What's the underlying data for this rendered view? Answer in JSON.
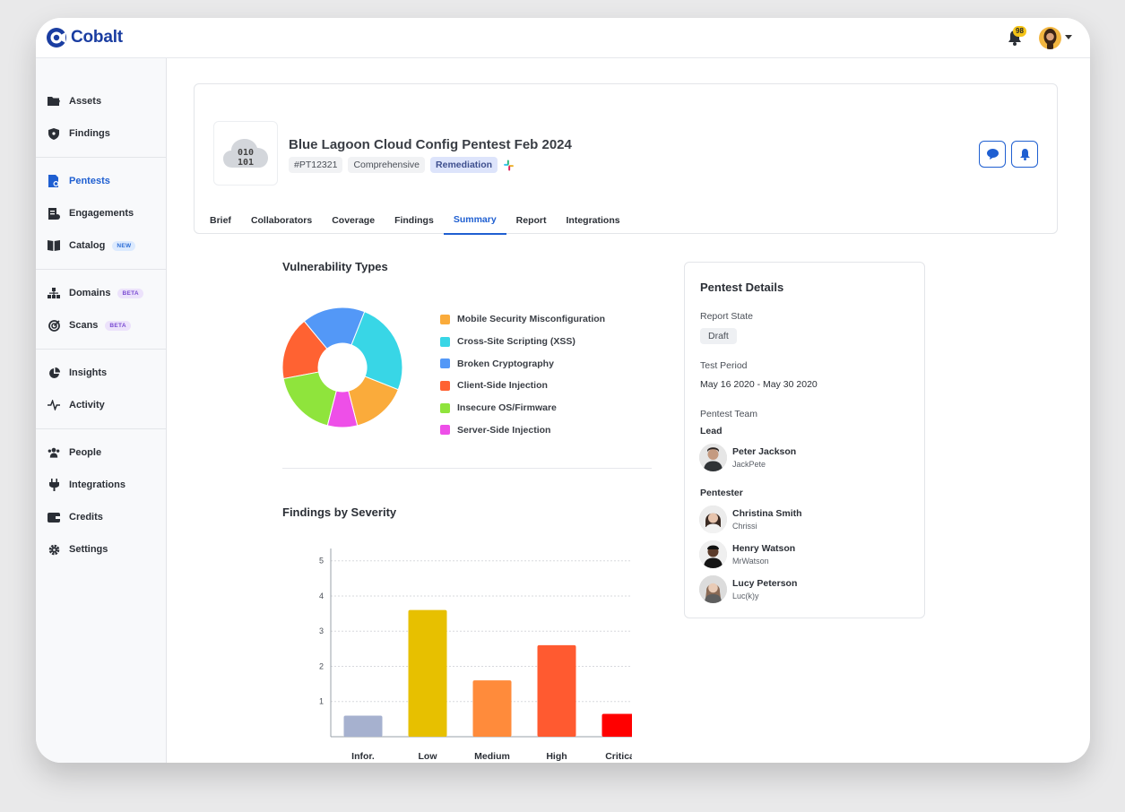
{
  "app": {
    "brand": "Cobalt",
    "notification_count": "98"
  },
  "sidebar": {
    "groups": [
      [
        {
          "label": "Assets",
          "icon": "folder-icon"
        },
        {
          "label": "Findings",
          "icon": "shield-icon"
        }
      ],
      [
        {
          "label": "Pentests",
          "icon": "pentest-doc-icon",
          "active": true
        },
        {
          "label": "Engagements",
          "icon": "engagement-icon"
        },
        {
          "label": "Catalog",
          "icon": "book-icon",
          "tag": "NEW"
        }
      ],
      [
        {
          "label": "Domains",
          "icon": "sitemap-icon",
          "tag": "BETA"
        },
        {
          "label": "Scans",
          "icon": "radar-icon",
          "tag": "BETA"
        }
      ],
      [
        {
          "label": "Insights",
          "icon": "pie-chart-icon"
        },
        {
          "label": "Activity",
          "icon": "pulse-icon"
        }
      ],
      [
        {
          "label": "People",
          "icon": "people-icon"
        },
        {
          "label": "Integrations",
          "icon": "plug-icon"
        },
        {
          "label": "Credits",
          "icon": "wallet-icon"
        },
        {
          "label": "Settings",
          "icon": "gear-icon"
        }
      ]
    ]
  },
  "pentest": {
    "title": "Blue Lagoon Cloud Config Pentest Feb 2024",
    "id_chip": "#PT12321",
    "type_chip": "Comprehensive",
    "state_chip": "Remediation",
    "icon_text_top": "010",
    "icon_text_bottom": "101"
  },
  "tabs": [
    "Brief",
    "Collaborators",
    "Coverage",
    "Findings",
    "Summary",
    "Report",
    "Integrations"
  ],
  "active_tab": "Summary",
  "vuln_section_title": "Vulnerability Types",
  "severity_section_title": "Findings by Severity",
  "details": {
    "title": "Pentest Details",
    "report_state_label": "Report State",
    "report_state": "Draft",
    "test_period_label": "Test Period",
    "test_period": "May 16 2020 - May 30 2020",
    "team_label": "Pentest Team",
    "lead_label": "Lead",
    "pentester_label": "Pentester",
    "lead": {
      "name": "Peter Jackson",
      "handle": "JackPete"
    },
    "pentesters": [
      {
        "name": "Christina Smith",
        "handle": "Chrissi"
      },
      {
        "name": "Henry Watson",
        "handle": "MrWatson"
      },
      {
        "name": "Lucy Peterson",
        "handle": "Luc(k)y"
      }
    ]
  },
  "chart_data": [
    {
      "type": "pie",
      "variant": "donut",
      "labels": [
        "Mobile Security Misconfiguration",
        "Cross-Site Scripting (XSS)",
        "Broken Cryptography",
        "Client-Side Injection",
        "Insecure OS/Firmware",
        "Server-Side Injection"
      ],
      "values": [
        15,
        25,
        17,
        17,
        18,
        8
      ],
      "colors": [
        "#faab3b",
        "#38d6e6",
        "#5398f7",
        "#ff6232",
        "#8fe43c",
        "#ee4fe8"
      ],
      "legend": "right"
    },
    {
      "type": "bar",
      "categories": [
        "Infor.",
        "Low",
        "Medium",
        "High",
        "Critical"
      ],
      "values": [
        0.6,
        3.6,
        1.6,
        2.6,
        0.65
      ],
      "colors": [
        "#a6b1cf",
        "#e7c000",
        "#ff8b3b",
        "#ff5a30",
        "#ff0000"
      ],
      "yticks": [
        1,
        2,
        3,
        4,
        5
      ],
      "ylim": [
        0,
        5.4
      ],
      "grid": true
    }
  ]
}
